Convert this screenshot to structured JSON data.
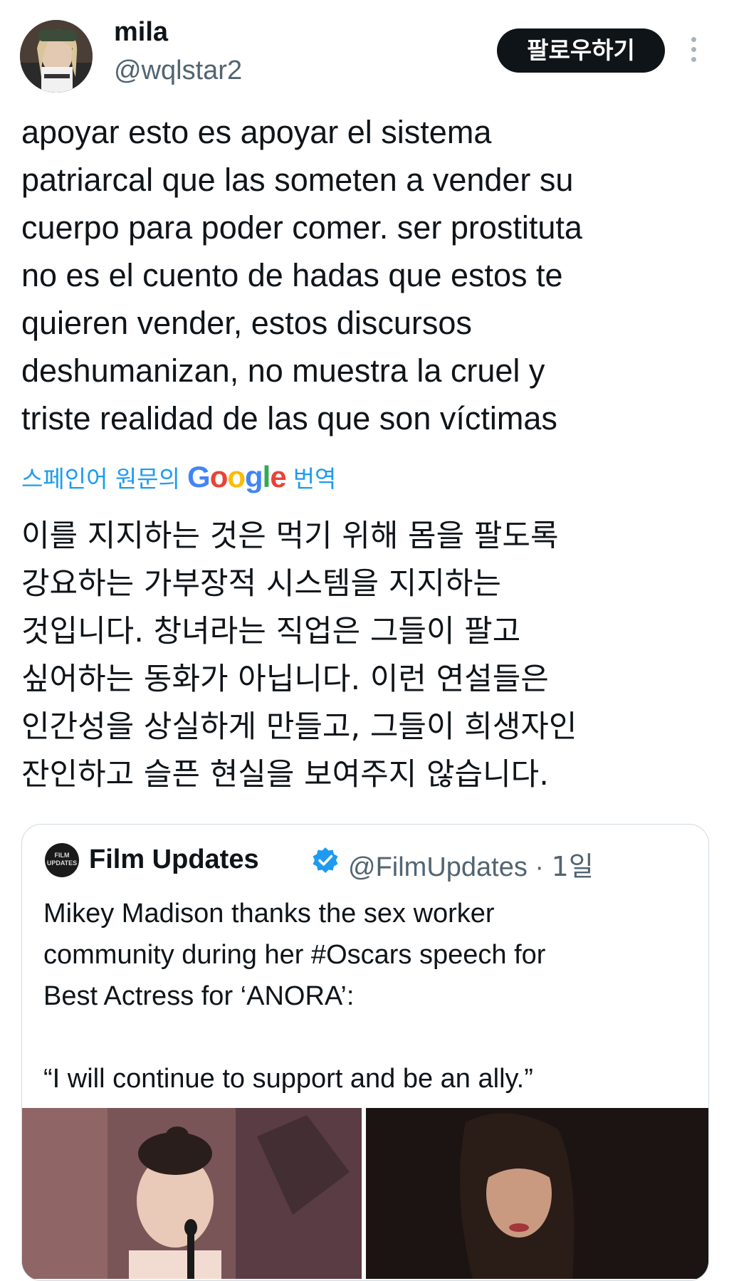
{
  "author": {
    "display_name": "mila",
    "handle": "@wqlstar2",
    "follow_label": "팔로우하기",
    "avatar_icon": "user-avatar-photo"
  },
  "tweet": {
    "text": "apoyar esto es apoyar el sistema\npatriarcal que las someten a vender su\ncuerpo para poder comer. ser prostituta\nno es el cuento de hadas que estos te\nquieren vender, estos discursos\ndeshumanizan, no muestra la cruel y\ntriste realidad de las que son víctimas",
    "translate_prefix": "스페인어 원문의",
    "translate_brand": "Google",
    "translate_suffix": "번역",
    "translated_text": "이를 지지하는 것은 먹기 위해 몸을 팔도록\n강요하는 가부장적 시스템을 지지하는\n것입니다. 창녀라는 직업은 그들이 팔고\n싶어하는 동화가 아닙니다. 이런 연설들은\n인간성을 상실하게 만들고, 그들이 희생자인\n잔인하고 슬픈 현실을 보여주지 않습니다."
  },
  "quote": {
    "display_name": "Film Updates",
    "handle": "@FilmUpdates",
    "separator": " · ",
    "time": "1일",
    "avatar_text": "FILM UPDATES",
    "text": "Mikey Madison thanks the sex worker\ncommunity during her #Oscars speech for\nBest Actress for ‘ANORA’:\n\n“I will continue to support and be an ally.”",
    "verified_color": "#1d9bf0"
  },
  "colors": {
    "text": "#0f1419",
    "secondary": "#536471",
    "link": "#1d9bf0",
    "border": "#cfd9de"
  }
}
